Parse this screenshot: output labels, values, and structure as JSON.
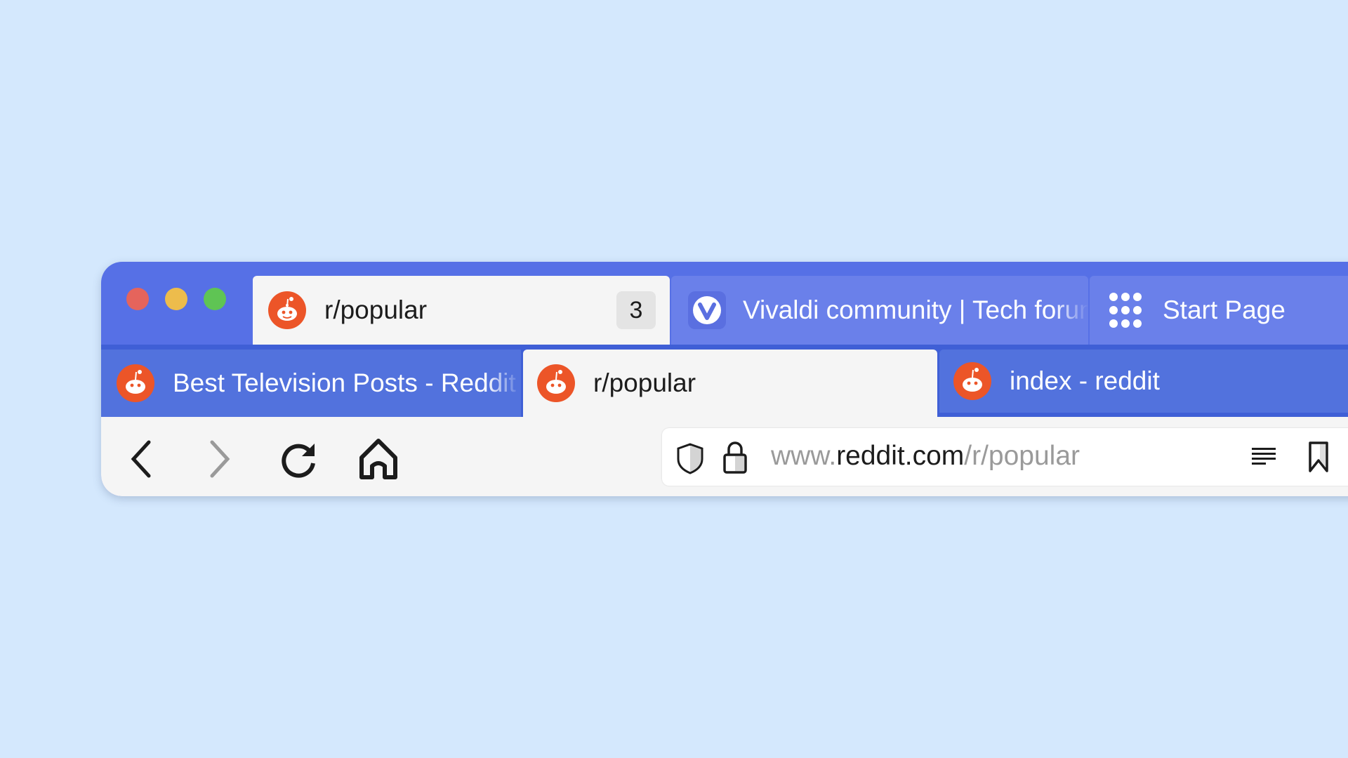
{
  "window_controls": {
    "close_color": "#e5645c",
    "minimize_color": "#edbc4c",
    "zoom_color": "#5fc454"
  },
  "top_tabs": [
    {
      "label": "r/popular",
      "count": "3",
      "icon": "reddit-icon",
      "active": true
    },
    {
      "label": "Vivaldi community | Tech forum",
      "icon": "vivaldi-icon",
      "active": false
    },
    {
      "label": "Start Page",
      "icon": "grid-icon",
      "active": false
    }
  ],
  "stack_tabs": [
    {
      "label": "Best Television Posts - Reddit",
      "icon": "reddit-icon",
      "active": false
    },
    {
      "label": "r/popular",
      "icon": "reddit-icon",
      "active": true
    },
    {
      "label": "index - reddit",
      "icon": "reddit-icon",
      "active": false
    }
  ],
  "address": {
    "prefix": "www.",
    "domain": "reddit.com",
    "path": "/r/popular"
  },
  "colors": {
    "background": "#d4e8fd",
    "tabbar": "#5670e6",
    "reddit": "#ec5528",
    "active_tab": "#f5f5f5"
  }
}
